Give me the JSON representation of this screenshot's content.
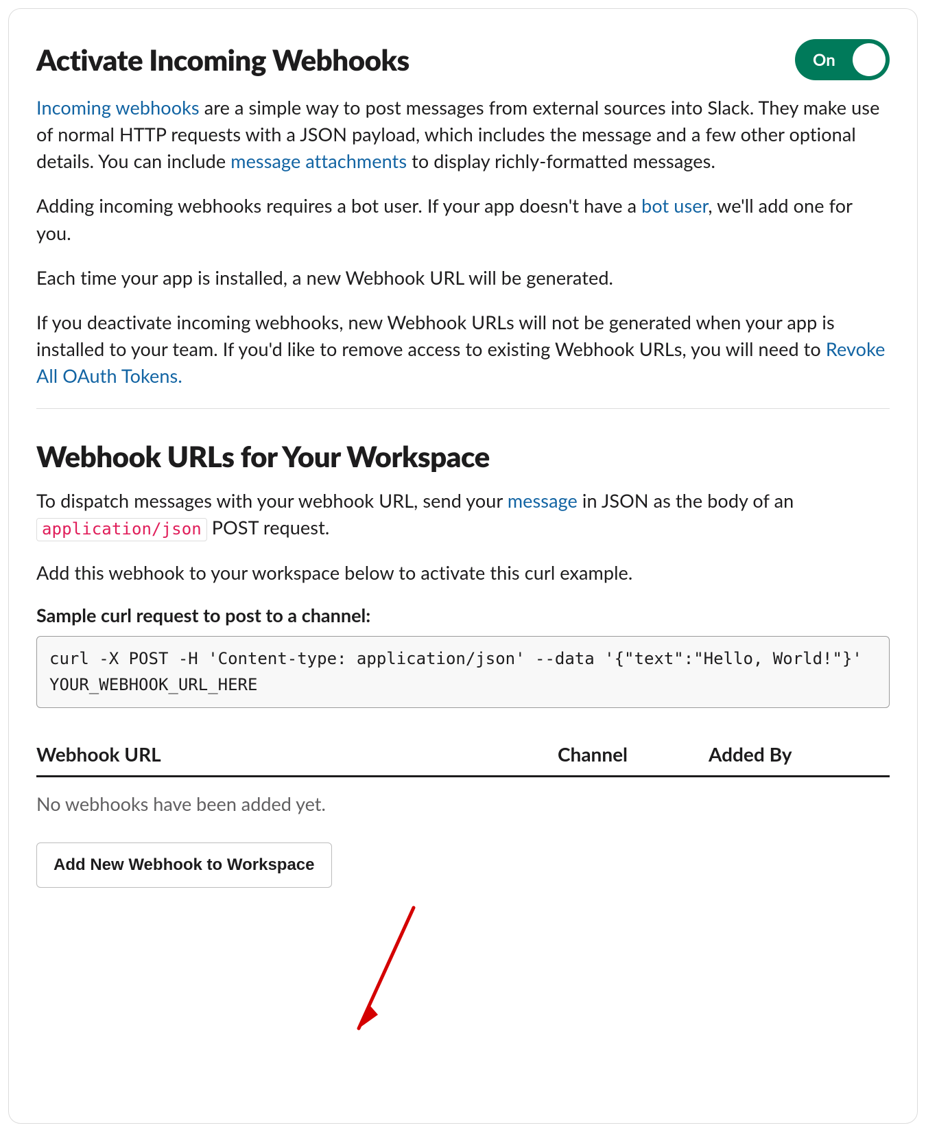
{
  "activate": {
    "title": "Activate Incoming Webhooks",
    "toggle_label": "On",
    "p1_a": "Incoming webhooks",
    "p1_b": " are a simple way to post messages from external sources into Slack. They make use of normal HTTP requests with a JSON payload, which includes the message and a few other optional details. You can include ",
    "p1_c": "message attachments",
    "p1_d": " to display richly-formatted messages.",
    "p2_a": "Adding incoming webhooks requires a bot user. If your app doesn't have a ",
    "p2_b": "bot user",
    "p2_c": ", we'll add one for you.",
    "p3": "Each time your app is installed, a new Webhook URL will be generated.",
    "p4_a": "If you deactivate incoming webhooks, new Webhook URLs will not be generated when your app is installed to your team. If you'd like to remove access to existing Webhook URLs, you will need to ",
    "p4_b": "Revoke All OAuth Tokens."
  },
  "urls": {
    "title": "Webhook URLs for Your Workspace",
    "p1_a": "To dispatch messages with your webhook URL, send your ",
    "p1_b": "message",
    "p1_c": " in JSON as the body of an ",
    "p1_code": "application/json",
    "p1_d": " POST request.",
    "p2": "Add this webhook to your workspace below to activate this curl example.",
    "sample_label": "Sample curl request to post to a channel:",
    "curl": "curl -X POST -H 'Content-type: application/json' --data '{\"text\":\"Hello, World!\"}' YOUR_WEBHOOK_URL_HERE",
    "table": {
      "col_url": "Webhook URL",
      "col_channel": "Channel",
      "col_added": "Added By",
      "empty": "No webhooks have been added yet."
    },
    "add_button": "Add New Webhook to Workspace"
  }
}
